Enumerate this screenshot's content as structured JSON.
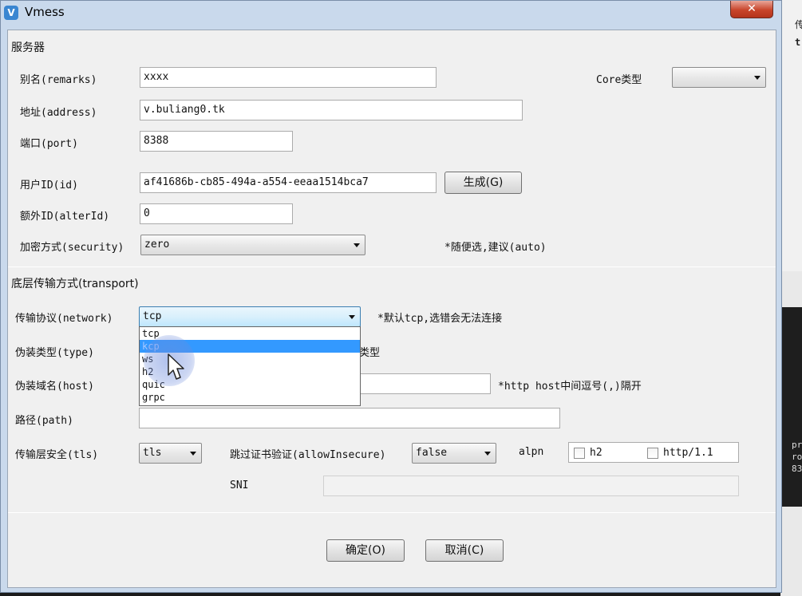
{
  "window": {
    "title": "Vmess",
    "close_glyph": "✕"
  },
  "background_window": {
    "text1": "传",
    "text2": "t",
    "terminal": [
      "pr",
      "ro",
      "83"
    ]
  },
  "server": {
    "section_title": "服务器",
    "remarks": {
      "label": "别名(remarks)",
      "value": "xxxx"
    },
    "core_type": {
      "label": "Core类型",
      "value": ""
    },
    "address": {
      "label": "地址(address)",
      "value": "v.buliang0.tk"
    },
    "port": {
      "label": "端口(port)",
      "value": "8388"
    },
    "user_id": {
      "label": "用户ID(id)",
      "value": "af41686b-cb85-494a-a554-eeaa1514bca7",
      "generate_button": "生成(G)"
    },
    "alter_id": {
      "label": "额外ID(alterId)",
      "value": "0"
    },
    "security": {
      "label": "加密方式(security)",
      "value": "zero",
      "hint": "*随便选,建议(auto)"
    }
  },
  "transport": {
    "section_title": "底层传输方式(transport)",
    "network": {
      "label": "传输协议(network)",
      "value": "tcp",
      "hint": "*默认tcp,选错会无法连接",
      "options": [
        "tcp",
        "kcp",
        "ws",
        "h2",
        "quic",
        "grpc"
      ],
      "highlighted_option": "kcp"
    },
    "type": {
      "label": "伪装类型(type)",
      "hint_tail": "类型"
    },
    "host": {
      "label": "伪装域名(host)",
      "value": "",
      "hint": "*http host中间逗号(,)隔开"
    },
    "path": {
      "label": "路径(path)",
      "value": ""
    },
    "tls": {
      "label": "传输层安全(tls)",
      "value": "tls"
    },
    "allow_insecure": {
      "label": "跳过证书验证(allowInsecure)",
      "value": "false"
    },
    "alpn": {
      "label": "alpn",
      "options": [
        {
          "label": "h2",
          "checked": false
        },
        {
          "label": "http/1.1",
          "checked": false
        }
      ]
    },
    "sni": {
      "label": "SNI",
      "value": ""
    }
  },
  "footer": {
    "ok_button": "确定(O)",
    "cancel_button": "取消(C)"
  },
  "colors": {
    "frame": "#c9d9ec",
    "client": "#f0f0f0",
    "highlight": "#3399ff",
    "close_button": "#c8452b"
  },
  "icons": {
    "app": "v2ray-logo-icon",
    "close": "close-icon",
    "dropdown": "chevron-down-icon",
    "pointer": "mouse-pointer-icon"
  }
}
